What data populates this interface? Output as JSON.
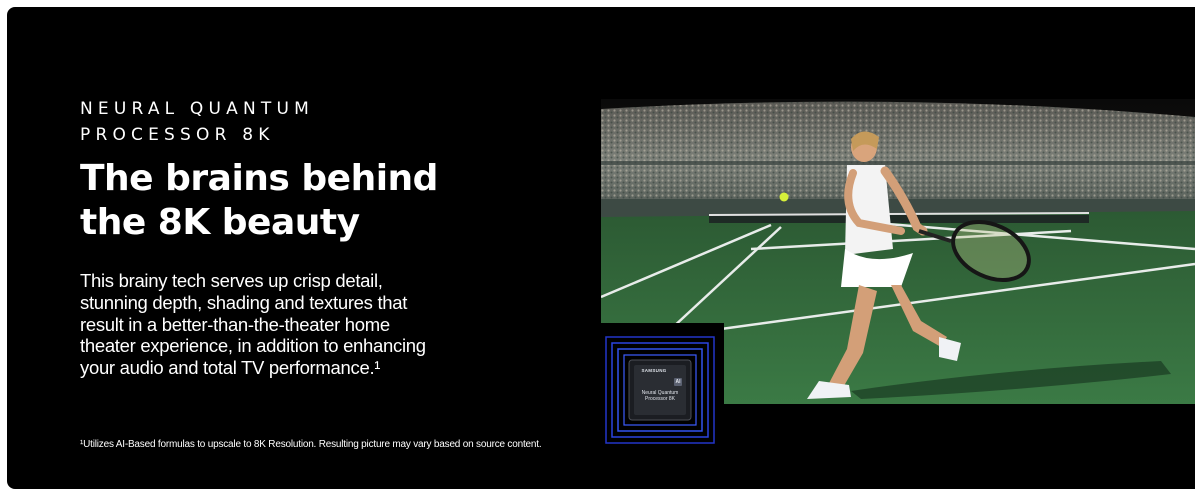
{
  "eyebrow": {
    "line1": "NEURAL QUANTUM",
    "line2": "PROCESSOR 8K"
  },
  "headline": {
    "line1": "The brains behind",
    "line2": "the 8K beauty"
  },
  "body": {
    "line1": "This brainy tech serves up crisp detail,",
    "line2": "stunning depth, shading and textures that",
    "line3": "result in a better-than-the-theater home",
    "line4": "theater experience, in addition to enhancing",
    "line5": "your audio and total TV performance.¹"
  },
  "footnote": "¹Utilizes AI-Based formulas to upscale to 8K Resolution. Resulting picture may vary based on source content.",
  "chip": {
    "brand": "SAMSUNG",
    "badge": "AI",
    "name_line1": "Neural Quantum",
    "name_line2": "Processor 8K"
  },
  "colors": {
    "background": "#000000",
    "text": "#ffffff",
    "court": "#2f6b3a",
    "chip_glow": "#2a3fd6"
  }
}
